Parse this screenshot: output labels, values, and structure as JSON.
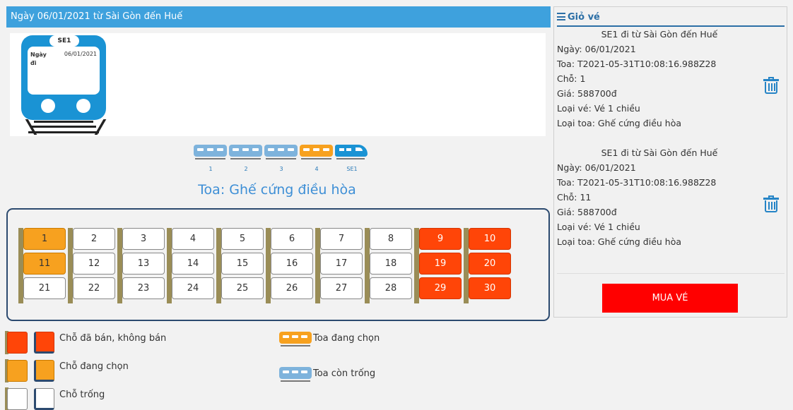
{
  "header": {
    "title": "Ngày 06/01/2021 từ Sài Gòn đến Huế"
  },
  "train": {
    "code": "SE1",
    "label": "Ngày đi",
    "date": "06/01/2021"
  },
  "coaches": [
    {
      "label": "1",
      "state": "free"
    },
    {
      "label": "2",
      "state": "free"
    },
    {
      "label": "3",
      "state": "free"
    },
    {
      "label": "4",
      "state": "selected"
    },
    {
      "label": "SE1",
      "state": "loco"
    }
  ],
  "toa_title": "Toa: Ghế cứng điều hòa",
  "seats": [
    {
      "n": "1",
      "state": "selected"
    },
    {
      "n": "2",
      "state": "free"
    },
    {
      "n": "3",
      "state": "free"
    },
    {
      "n": "4",
      "state": "free"
    },
    {
      "n": "5",
      "state": "free"
    },
    {
      "n": "6",
      "state": "free"
    },
    {
      "n": "7",
      "state": "free"
    },
    {
      "n": "8",
      "state": "free"
    },
    {
      "n": "9",
      "state": "sold"
    },
    {
      "n": "10",
      "state": "sold"
    },
    {
      "n": "11",
      "state": "selected"
    },
    {
      "n": "12",
      "state": "free"
    },
    {
      "n": "13",
      "state": "free"
    },
    {
      "n": "14",
      "state": "free"
    },
    {
      "n": "15",
      "state": "free"
    },
    {
      "n": "16",
      "state": "free"
    },
    {
      "n": "17",
      "state": "free"
    },
    {
      "n": "18",
      "state": "free"
    },
    {
      "n": "19",
      "state": "sold"
    },
    {
      "n": "20",
      "state": "sold"
    },
    {
      "n": "21",
      "state": "free"
    },
    {
      "n": "22",
      "state": "free"
    },
    {
      "n": "23",
      "state": "free"
    },
    {
      "n": "24",
      "state": "free"
    },
    {
      "n": "25",
      "state": "free"
    },
    {
      "n": "26",
      "state": "free"
    },
    {
      "n": "27",
      "state": "free"
    },
    {
      "n": "28",
      "state": "free"
    },
    {
      "n": "29",
      "state": "sold"
    },
    {
      "n": "30",
      "state": "sold"
    }
  ],
  "cart": {
    "title": "Giỏ vé",
    "icon": "list-icon",
    "tickets": [
      {
        "route": "SE1 đi từ Sài Gòn đến Huế",
        "date": "Ngày: 06/01/2021",
        "toa": "Toa: T2021-05-31T10:08:16.988Z28",
        "seat": "Chỗ: 1",
        "price": "Giá: 588700đ",
        "ticket_type": "Loại vé: Vé 1 chiều",
        "coach_type": "Loại toa: Ghế cứng điều hòa"
      },
      {
        "route": "SE1 đi từ Sài Gòn đến Huế",
        "date": "Ngày: 06/01/2021",
        "toa": "Toa: T2021-05-31T10:08:16.988Z28",
        "seat": "Chỗ: 11",
        "price": "Giá: 588700đ",
        "ticket_type": "Loại vé: Vé 1 chiều",
        "coach_type": "Loại toa: Ghế cứng điều hòa"
      }
    ],
    "buy_label": "MUA VÉ"
  },
  "legend": {
    "sold": "Chỗ đã bán, không bán",
    "selected": "Chỗ đang chọn",
    "free": "Chỗ trống",
    "coach_selected": "Toa đang chọn",
    "coach_free": "Toa còn trống"
  },
  "colors": {
    "header_bg": "#3ea1dd",
    "sold": "#ff4508",
    "selected": "#f7a11f",
    "coach_free": "#7eb3dc",
    "loco": "#1a93d4",
    "buy_button": "#ff0000"
  }
}
